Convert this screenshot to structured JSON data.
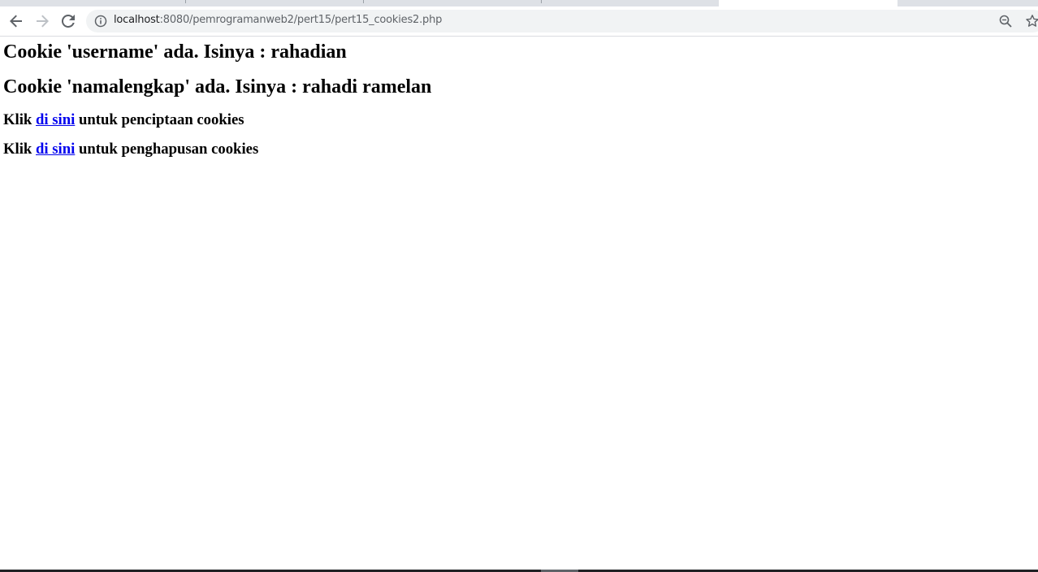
{
  "browser": {
    "url_host": "localhost",
    "url_path": ":8080/pemrogramanweb2/pert15/pert15_cookies2.php"
  },
  "page": {
    "line1": "Cookie 'username' ada. Isinya : rahadian",
    "line2": "Cookie 'namalengkap' ada. Isinya : rahadi ramelan",
    "line3_prefix": "Klik ",
    "line3_link": "di sini",
    "line3_suffix": " untuk penciptaan cookies",
    "line4_prefix": "Klik ",
    "line4_link": "di sini",
    "line4_suffix": " untuk penghapusan cookies"
  },
  "colors": {
    "link": "#0000ee",
    "text": "#000000",
    "omnibox": "#f1f3f4"
  }
}
